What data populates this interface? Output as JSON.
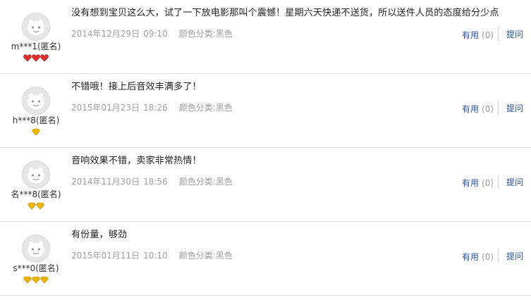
{
  "reviews": [
    {
      "user": "m***1(匿名)",
      "badge_type": "heart",
      "badge_count": 3,
      "content": "没有想到宝贝这么大，试了一下放电影那叫个震憾！星期六天快递不送货，所以送件人员的态度给分少点",
      "date": "2014年12月29日",
      "time": "09:10",
      "sku": "颜色分类:黑色",
      "useful_label": "有用",
      "useful_count": "(0)",
      "reply_label": "提问"
    },
    {
      "user": "h***8(匿名)",
      "badge_type": "diamond",
      "badge_count": 1,
      "content": "不错哦！接上后音效丰满多了！",
      "date": "2015年01月23日",
      "time": "18:26",
      "sku": "颜色分类:黑色",
      "useful_label": "有用",
      "useful_count": "(0)",
      "reply_label": "提问"
    },
    {
      "user": "名***8(匿名)",
      "badge_type": "diamond",
      "badge_count": 2,
      "content": "音响效果不错，卖家非常热情！",
      "date": "2014年11月30日",
      "time": "18:56",
      "sku": "颜色分类:黑色",
      "useful_label": "有用",
      "useful_count": "(0)",
      "reply_label": "提问"
    },
    {
      "user": "s***0(匿名)",
      "badge_type": "diamond",
      "badge_count": 3,
      "content": "有份量，够劲",
      "date": "2015年01月11日",
      "time": "10:10",
      "sku": "颜色分类:黑色",
      "useful_label": "有用",
      "useful_count": "(0)",
      "reply_label": "提问"
    }
  ],
  "colors": {
    "link": "#2953a6",
    "meta_text": "#a0a0a0",
    "heart": "#e0302a",
    "diamond": "#f0b400",
    "divider": "#dcdcdc"
  },
  "icons": {
    "avatar": "default-avatar-icon",
    "heart": "red-heart-badge-icon",
    "diamond": "yellow-diamond-badge-icon"
  }
}
